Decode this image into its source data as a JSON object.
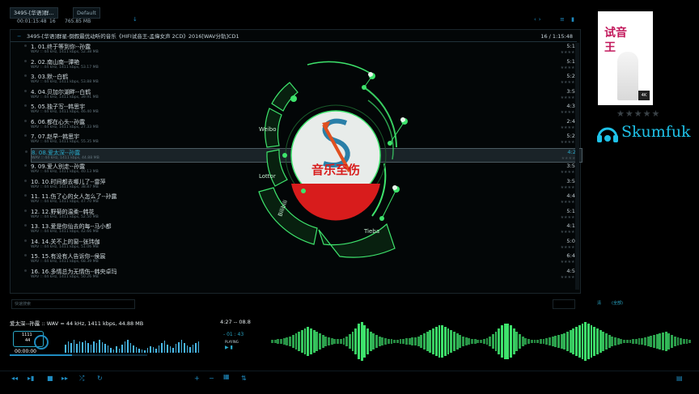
{
  "tabs": [
    {
      "label": "3495-[华语]群..."
    },
    {
      "label": "Default"
    }
  ],
  "info": {
    "elapsed": "00:01:15:48",
    "count": "16",
    "size": "765.85 MB"
  },
  "playlist": {
    "header_title": "3495-[华语]群星-倒叙最优动听的音乐《HIFI试音王-孟偉女声 2CD》2016[WAV分轨]CD1",
    "header_right": "16 / 1:15:48",
    "tracks": [
      {
        "title": "1. 01.终于等到你--孙露",
        "details": "WAV :: 44 kHz, 1411 kbps, 52.38 MB",
        "duration": "5:11"
      },
      {
        "title": "2. 02.南山南--谭艳",
        "details": "WAV :: 44 kHz, 1411 kbps, 53.17 MB",
        "duration": "5:16"
      },
      {
        "title": "3. 03.默--白鹤",
        "details": "WAV :: 44 kHz, 1411 kbps, 53.88 MB",
        "duration": "5:20"
      },
      {
        "title": "4. 04.贝加尔湖畔--白鹤",
        "details": "WAV :: 44 kHz, 1411 kbps, 39.91 MB",
        "duration": "3:57"
      },
      {
        "title": "5. 05.独子写--韩思宇",
        "details": "WAV :: 44 kHz, 1411 kbps, 46.40 MB",
        "duration": "4:36"
      },
      {
        "title": "6. 06.都在心头--孙露",
        "details": "WAV :: 44 kHz, 1411 kbps, 27.33 MB",
        "duration": "2:42"
      },
      {
        "title": "7. 07.赵早--韩思宇",
        "details": "WAV :: 44 kHz, 1411 kbps, 55.35 MB",
        "duration": "5:29"
      },
      {
        "title": "8. 08.爱太深--孙露",
        "details": "WAV :: 44 kHz, 1411 kbps, 44.88 MB",
        "duration": "4:27"
      },
      {
        "title": "9. 09.爱人别走--孙露",
        "details": "WAV :: 44 kHz, 1411 kbps, 40.13 MB",
        "duration": "3:59"
      },
      {
        "title": "10. 10.时间都去哪儿了--雷萍",
        "details": "WAV :: 44 kHz, 1411 kbps, 38.87 MB",
        "duration": "3:52"
      },
      {
        "title": "11. 11.伤了心的女人怎么了--孙露",
        "details": "WAV :: 44 kHz, 1411 kbps, 47.70 MB",
        "duration": "4:44"
      },
      {
        "title": "12. 12.野菊的温柔--韩花",
        "details": "WAV :: 44 kHz, 1411 kbps, 52.50 MB",
        "duration": "5:12"
      },
      {
        "title": "13. 13.爱是你仙去的每--马小都",
        "details": "WAV :: 44 kHz, 1411 kbps, 42.66 MB",
        "duration": "4:14"
      },
      {
        "title": "14. 14.关不上的窗--张玮伽",
        "details": "WAV :: 44 kHz, 1411 kbps, 51.06 MB",
        "duration": "5:03"
      },
      {
        "title": "15. 15.有没有人告诉你--侯宸",
        "details": "WAV :: 44 kHz, 1411 kbps, 68.39 MB",
        "duration": "6:47"
      },
      {
        "title": "16. 16.多情总为无情伤--韩央卓玛",
        "details": "WAV :: 44 kHz, 1411 kbps, 50.26 MB",
        "duration": "4:59"
      }
    ],
    "selected_index": 7
  },
  "overlay": {
    "logo_text": "音乐至伤",
    "ring_labels": [
      "Weibo",
      "Lottor",
      "Bilibili",
      "Tieba"
    ],
    "accent": "#3ee36c"
  },
  "brand": {
    "name": "Skumfuk",
    "accent": "#1ec2e8"
  },
  "cover": {
    "title": "试音王",
    "badge": "4K"
  },
  "search": {
    "placeholder": "快速搜索"
  },
  "side_buttons": {
    "a": "清",
    "b": "(全部)"
  },
  "now_playing": {
    "text": "爱太深--孙露 :: WAV = 44 kHz, 1411 kbps, 44.88 MB",
    "time_right": "4:27 -- 08.8",
    "remain": "- 01 : 43",
    "state": "PLAYING",
    "clock": "00:00:00",
    "spin_hi": "1111",
    "spin_lo": "44"
  },
  "colors": {
    "accent": "#1f8cc1",
    "wave": "#3ee36c",
    "panel": "#0a1a24"
  }
}
